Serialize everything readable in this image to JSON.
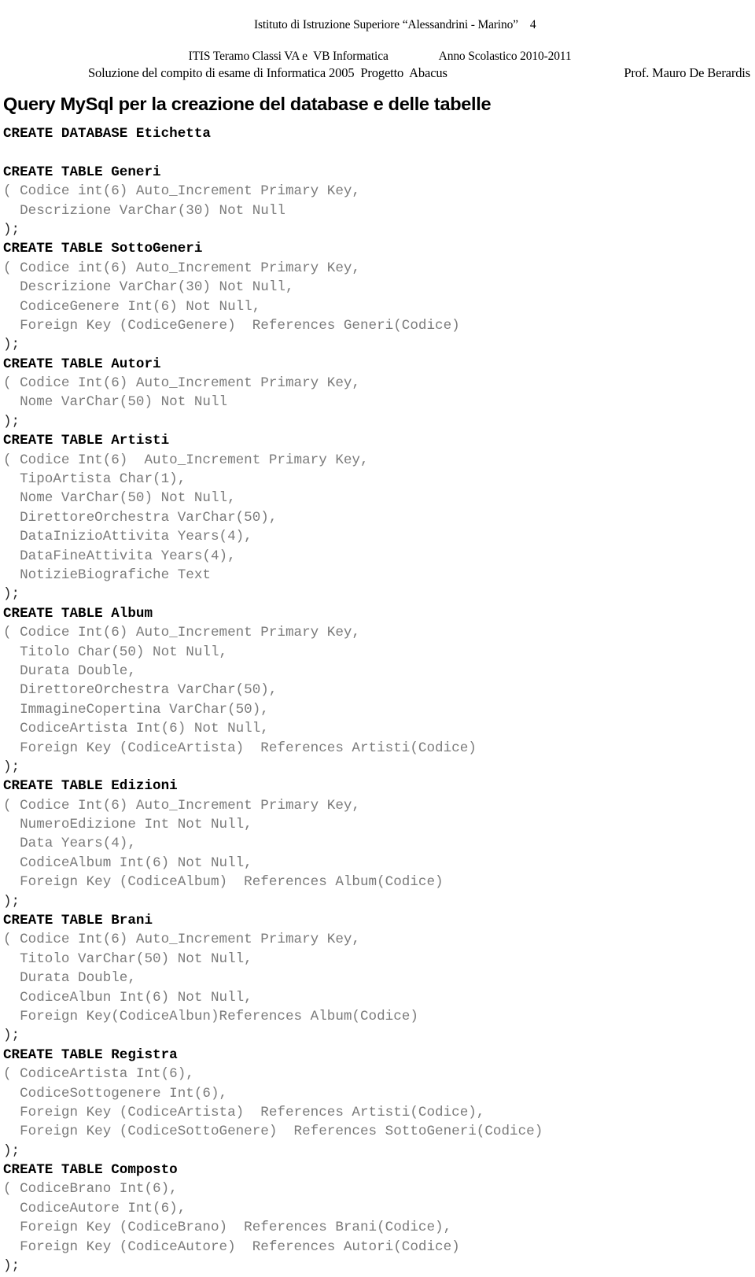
{
  "header": {
    "line1": "Istituto di Istruzione Superiore “Alessandrini - Marino”",
    "page_number": "4",
    "line2_left": "ITIS Teramo Classi VA e  VB Informatica",
    "line2_right": "Anno Scolastico 2010-2011",
    "line3_left": "Soluzione del compito di esame di Informatica 2005  Progetto  Abacus",
    "line3_right": "Prof. Mauro De Berardis"
  },
  "title": "Query MySql per la creazione del database e delle tabelle",
  "colors": {
    "keyword": "#000000",
    "body_text": "#7b7b7b",
    "close_paren": "#2b2b2b",
    "background": "#ffffff"
  },
  "code": [
    {
      "kind": "kw",
      "text": "CREATE DATABASE Etichetta"
    },
    {
      "kind": "blank",
      "text": " "
    },
    {
      "kind": "kw",
      "text": "CREATE TABLE Generi"
    },
    {
      "kind": "body",
      "text": "( Codice int(6) Auto_Increment Primary Key,"
    },
    {
      "kind": "body",
      "text": "  Descrizione VarChar(30) Not Null"
    },
    {
      "kind": "close",
      "text": ");"
    },
    {
      "kind": "kw",
      "text": "CREATE TABLE SottoGeneri"
    },
    {
      "kind": "body",
      "text": "( Codice int(6) Auto_Increment Primary Key,"
    },
    {
      "kind": "body",
      "text": "  Descrizione VarChar(30) Not Null,"
    },
    {
      "kind": "body",
      "text": "  CodiceGenere Int(6) Not Null,"
    },
    {
      "kind": "body",
      "text": "  Foreign Key (CodiceGenere)  References Generi(Codice)"
    },
    {
      "kind": "close",
      "text": ");"
    },
    {
      "kind": "kw",
      "text": "CREATE TABLE Autori"
    },
    {
      "kind": "body",
      "text": "( Codice Int(6) Auto_Increment Primary Key,"
    },
    {
      "kind": "body",
      "text": "  Nome VarChar(50) Not Null"
    },
    {
      "kind": "close",
      "text": ");"
    },
    {
      "kind": "kw",
      "text": "CREATE TABLE Artisti"
    },
    {
      "kind": "body",
      "text": "( Codice Int(6)  Auto_Increment Primary Key,"
    },
    {
      "kind": "body",
      "text": "  TipoArtista Char(1),"
    },
    {
      "kind": "body",
      "text": "  Nome VarChar(50) Not Null,"
    },
    {
      "kind": "body",
      "text": "  DirettoreOrchestra VarChar(50),"
    },
    {
      "kind": "body",
      "text": "  DataInizioAttivita Years(4),"
    },
    {
      "kind": "body",
      "text": "  DataFineAttivita Years(4),"
    },
    {
      "kind": "body",
      "text": "  NotizieBiografiche Text"
    },
    {
      "kind": "close",
      "text": ");"
    },
    {
      "kind": "kw",
      "text": "CREATE TABLE Album"
    },
    {
      "kind": "body",
      "text": "( Codice Int(6) Auto_Increment Primary Key,"
    },
    {
      "kind": "body",
      "text": "  Titolo Char(50) Not Null,"
    },
    {
      "kind": "body",
      "text": "  Durata Double,"
    },
    {
      "kind": "body",
      "text": "  DirettoreOrchestra VarChar(50),"
    },
    {
      "kind": "body",
      "text": "  ImmagineCopertina VarChar(50),"
    },
    {
      "kind": "body",
      "text": "  CodiceArtista Int(6) Not Null,"
    },
    {
      "kind": "body",
      "text": "  Foreign Key (CodiceArtista)  References Artisti(Codice)"
    },
    {
      "kind": "close",
      "text": ");"
    },
    {
      "kind": "kw",
      "text": "CREATE TABLE Edizioni"
    },
    {
      "kind": "body",
      "text": "( Codice Int(6) Auto_Increment Primary Key,"
    },
    {
      "kind": "body",
      "text": "  NumeroEdizione Int Not Null,"
    },
    {
      "kind": "body",
      "text": "  Data Years(4),"
    },
    {
      "kind": "body",
      "text": "  CodiceAlbum Int(6) Not Null,"
    },
    {
      "kind": "body",
      "text": "  Foreign Key (CodiceAlbum)  References Album(Codice)"
    },
    {
      "kind": "close",
      "text": ");"
    },
    {
      "kind": "kw",
      "text": "CREATE TABLE Brani"
    },
    {
      "kind": "body",
      "text": "( Codice Int(6) Auto_Increment Primary Key,"
    },
    {
      "kind": "body",
      "text": "  Titolo VarChar(50) Not Null,"
    },
    {
      "kind": "body",
      "text": "  Durata Double,"
    },
    {
      "kind": "body",
      "text": "  CodiceAlbun Int(6) Not Null,"
    },
    {
      "kind": "body",
      "text": "  Foreign Key(CodiceAlbun)References Album(Codice)"
    },
    {
      "kind": "close",
      "text": ");"
    },
    {
      "kind": "kw",
      "text": "CREATE TABLE Registra"
    },
    {
      "kind": "body",
      "text": "( CodiceArtista Int(6),"
    },
    {
      "kind": "body",
      "text": "  CodiceSottogenere Int(6),"
    },
    {
      "kind": "body",
      "text": "  Foreign Key (CodiceArtista)  References Artisti(Codice),"
    },
    {
      "kind": "body",
      "text": "  Foreign Key (CodiceSottoGenere)  References SottoGeneri(Codice)"
    },
    {
      "kind": "close",
      "text": ");"
    },
    {
      "kind": "kw",
      "text": "CREATE TABLE Composto"
    },
    {
      "kind": "body",
      "text": "( CodiceBrano Int(6),"
    },
    {
      "kind": "body",
      "text": "  CodiceAutore Int(6),"
    },
    {
      "kind": "body",
      "text": "  Foreign Key (CodiceBrano)  References Brani(Codice),"
    },
    {
      "kind": "body",
      "text": "  Foreign Key (CodiceAutore)  References Autori(Codice)"
    },
    {
      "kind": "close",
      "text": ");"
    }
  ]
}
